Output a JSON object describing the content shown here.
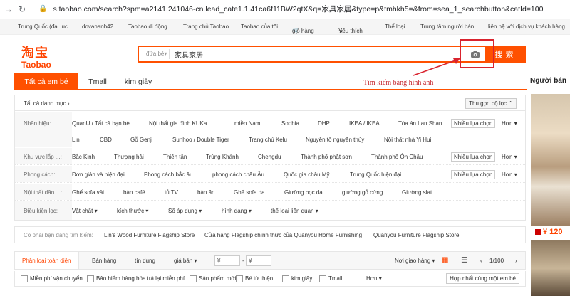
{
  "browser": {
    "url": "s.taobao.com/search?spm=a2141.241046-cn.lead_cate1.1.41ca6f11BW2qtX&q=家具家居&type=p&tmhkh5=&from=sea_1_searchbutton&catId=100"
  },
  "sitenav": {
    "items": [
      "Trung Quốc (đại lục",
      "dovananh42",
      "Taobao di động",
      "Trang chủ Taobao",
      "Taobao của tôi",
      "giỏ hàng",
      "Yêu thích",
      "Thể loại",
      "Trung tâm người bán",
      "liên hệ với dịch vụ khách hàng"
    ]
  },
  "logo": {
    "cn": "淘宝",
    "en": "Taobao"
  },
  "search": {
    "category": "đứa bé",
    "query": "家具家居",
    "button": "搜索"
  },
  "annotation": {
    "text": "Tìm kiếm bằng hình ảnh"
  },
  "tabs": [
    "Tất cả em bé",
    "Tmall",
    "kim giây"
  ],
  "side": {
    "title": "Người bán",
    "price": "¥ 120"
  },
  "filters": {
    "all_categories": "Tất cả danh mục",
    "collapse": "Thu gọn bộ lọc",
    "multi": "Nhiều lựa chọn",
    "more": "Hơn",
    "brand_label": "Nhãn hiệu:",
    "brands_row1": [
      "QuanU / Tất cả bạn bè",
      "Nội thất gia đình KUKa ...",
      "miền Nam",
      "Sophia",
      "DHP",
      "IKEA / IKEA",
      "Tòa án Lan Shan"
    ],
    "brands_row2": [
      "Lin",
      "CBD",
      "Gỗ Genji",
      "Sunhoo / Double Tiger",
      "Trang chủ Kelu",
      "Nguyên tố nguyên thủy",
      "Nội thất nhà Yi Hui"
    ],
    "area_label": "Khu vực lắp ...:",
    "areas": [
      "Bắc Kinh",
      "Thượng hải",
      "Thiên tân",
      "Trùng Khánh",
      "Chengdu",
      "Thành phố phật sơn",
      "Thành phố Ôn Châu"
    ],
    "style_label": "Phong cách:",
    "styles": [
      "Đơn giản và hiện đại",
      "Phong cách bắc âu",
      "phong cách châu Âu",
      "Quốc gia châu Mỹ",
      "Trung Quốc hiện đại"
    ],
    "furniture_label": "Nội thất dân ...:",
    "furniture": [
      "Ghế sofa vải",
      "bàn café",
      "tủ TV",
      "bàn ăn",
      "Ghế sofa da",
      "Giường bọc da",
      "giường gỗ cứng",
      "Giường slat"
    ],
    "cond_label": "Điều kiện lọc:",
    "conds": [
      "Vật chất",
      "kích thước",
      "Số áp dụng",
      "hình dạng",
      "thể loại liên quan"
    ]
  },
  "related": {
    "label": "Có phải bạn đang tìm kiếm:",
    "items": [
      "Lin's Wood Furniture Flagship Store",
      "Cửa hàng Flagship chính thức của Quanyou Home Furnishing",
      "Quanyou Furniture Flagship Store"
    ]
  },
  "sortbar": {
    "items": [
      "Phân loại toàn diện",
      "Bán hàng",
      "tín dụng",
      "giá bán"
    ],
    "price_from": "¥",
    "price_to": "¥",
    "delivery": "Nơi giao hàng",
    "page": "1/100"
  },
  "checks": {
    "items": [
      "Miễn phí vận chuyển",
      "Bảo hiểm hàng hóa trả lại miễn phí",
      "Sản phẩm mới",
      "Bé từ thiện",
      "kim giây",
      "Tmall"
    ],
    "more": "Hơn",
    "button": "Hợp nhất cùng một em bé"
  }
}
